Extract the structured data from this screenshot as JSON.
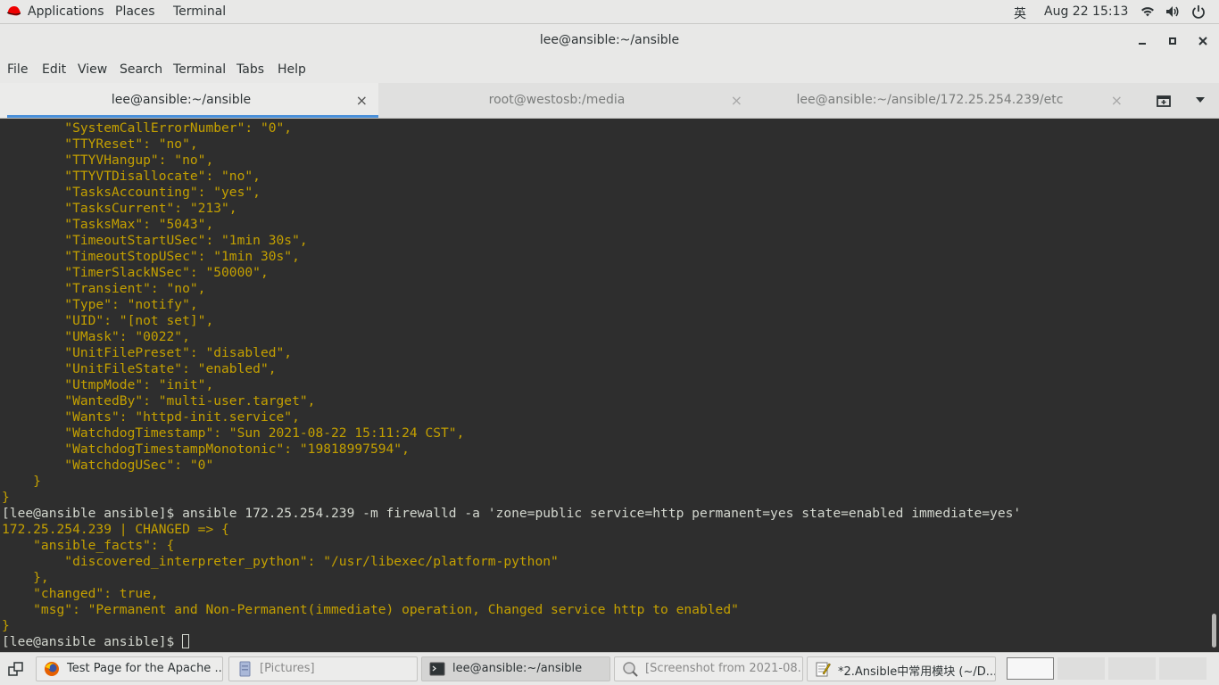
{
  "topbar": {
    "applications": "Applications",
    "places": "Places",
    "terminal": "Terminal",
    "input_method": "英",
    "clock": "Aug 22  15:13",
    "icons": [
      "redhat-icon",
      "wifi-icon",
      "volume-icon",
      "power-icon"
    ]
  },
  "window": {
    "title": "lee@ansible:~/ansible",
    "controls": [
      "minimize-icon",
      "maximize-icon",
      "close-icon"
    ]
  },
  "menubar": {
    "file": "File",
    "edit": "Edit",
    "view": "View",
    "search": "Search",
    "terminal": "Terminal",
    "tabs": "Tabs",
    "help": "Help"
  },
  "tabs": [
    {
      "label": "lee@ansible:~/ansible",
      "close": "×",
      "active": true
    },
    {
      "label": "root@westosb:/media",
      "close": "×",
      "active": false
    },
    {
      "label": "lee@ansible:~/ansible/172.25.254.239/etc",
      "close": "×",
      "active": false
    }
  ],
  "terminal": {
    "lines": [
      "        \"SystemCallErrorNumber\": \"0\",",
      "        \"TTYReset\": \"no\",",
      "        \"TTYVHangup\": \"no\",",
      "        \"TTYVTDisallocate\": \"no\",",
      "        \"TasksAccounting\": \"yes\",",
      "        \"TasksCurrent\": \"213\",",
      "        \"TasksMax\": \"5043\",",
      "        \"TimeoutStartUSec\": \"1min 30s\",",
      "        \"TimeoutStopUSec\": \"1min 30s\",",
      "        \"TimerSlackNSec\": \"50000\",",
      "        \"Transient\": \"no\",",
      "        \"Type\": \"notify\",",
      "        \"UID\": \"[not set]\",",
      "        \"UMask\": \"0022\",",
      "        \"UnitFilePreset\": \"disabled\",",
      "        \"UnitFileState\": \"enabled\",",
      "        \"UtmpMode\": \"init\",",
      "        \"WantedBy\": \"multi-user.target\",",
      "        \"Wants\": \"httpd-init.service\",",
      "        \"WatchdogTimestamp\": \"Sun 2021-08-22 15:11:24 CST\",",
      "        \"WatchdogTimestampMonotonic\": \"19818997594\",",
      "        \"WatchdogUSec\": \"0\"",
      "    }",
      "}",
      "[lee@ansible ansible]$ ansible 172.25.254.239 -m firewalld -a 'zone=public service=http permanent=yes state=enabled immediate=yes'",
      "172.25.254.239 | CHANGED => {",
      "    \"ansible_facts\": {",
      "        \"discovered_interpreter_python\": \"/usr/libexec/platform-python\"",
      "    },",
      "    \"changed\": true,",
      "    \"msg\": \"Permanent and Non-Permanent(immediate) operation, Changed service http to enabled\"",
      "}"
    ],
    "prompt": "[lee@ansible ansible]$ ",
    "colors": {
      "background": "#2e2e2e",
      "output": "#c4a000",
      "prompt": "#d3d7cf"
    }
  },
  "taskbar": {
    "items": [
      {
        "label": "Test Page for the Apache ...",
        "icon": "firefox-icon"
      },
      {
        "label": "[Pictures]",
        "icon": "folder-icon"
      },
      {
        "label": "lee@ansible:~/ansible",
        "icon": "terminal-icon"
      },
      {
        "label": "[Screenshot from 2021-08...",
        "icon": "screenshot-icon"
      },
      {
        "label": "*2.Ansible中常用模块 (~/D...",
        "icon": "text-editor-icon"
      }
    ],
    "workspaces": 4
  }
}
